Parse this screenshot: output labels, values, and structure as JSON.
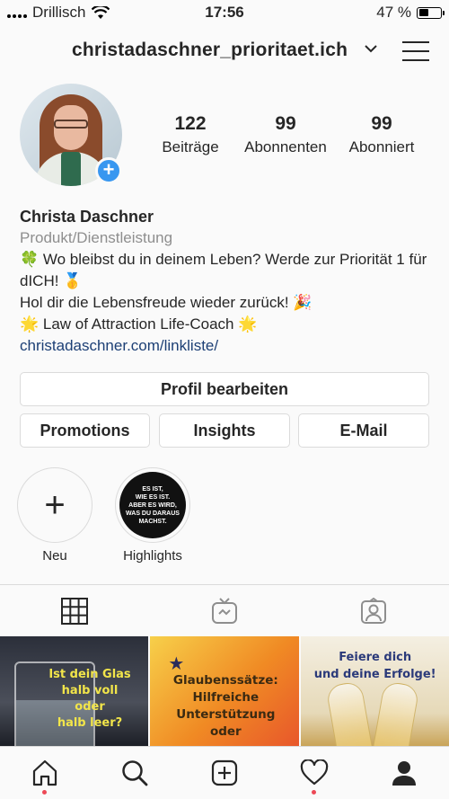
{
  "status_bar": {
    "carrier": "Drillisch",
    "time": "17:56",
    "battery_text": "47 %",
    "battery_level": 0.47
  },
  "header": {
    "username": "christadaschner_prioritaet.ich"
  },
  "stats": [
    {
      "value": "122",
      "label": "Beiträge"
    },
    {
      "value": "99",
      "label": "Abonnenten"
    },
    {
      "value": "99",
      "label": "Abonniert"
    }
  ],
  "bio": {
    "name": "Christa Daschner",
    "category": "Produkt/Dienstleistung",
    "line1": "🍀 Wo bleibst du in deinem Leben? Werde zur Priorität 1 für dICH! 🥇",
    "line2": "Hol dir die Lebensfreude wieder zurück! 🎉",
    "line3": "🌟 Law of Attraction Life-Coach 🌟",
    "link": "christadaschner.com/linkliste/"
  },
  "buttons": {
    "edit_profile": "Profil bearbeiten",
    "promotions": "Promotions",
    "insights": "Insights",
    "email": "E-Mail"
  },
  "highlights": {
    "new_label": "Neu",
    "highlight_label": "Highlights",
    "cover_text": [
      "ES IST,",
      "WIE ES IST.",
      "ABER ES WIRD,",
      "WAS DU DARAUS",
      "MACHST."
    ]
  },
  "posts": [
    {
      "text": [
        "Ist dein Glas",
        "halb voll",
        "oder",
        "halb leer?"
      ]
    },
    {
      "text": [
        "Glaubenssätze:",
        "Hilfreiche",
        "Unterstützung",
        "oder"
      ]
    },
    {
      "text": [
        "Feiere dich",
        "und deine Erfolge!"
      ]
    }
  ],
  "colors": {
    "accent_blue": "#3897f0",
    "link_blue": "#1c3f75",
    "notification_red": "#ed4956",
    "border": "#dbdbdb"
  }
}
